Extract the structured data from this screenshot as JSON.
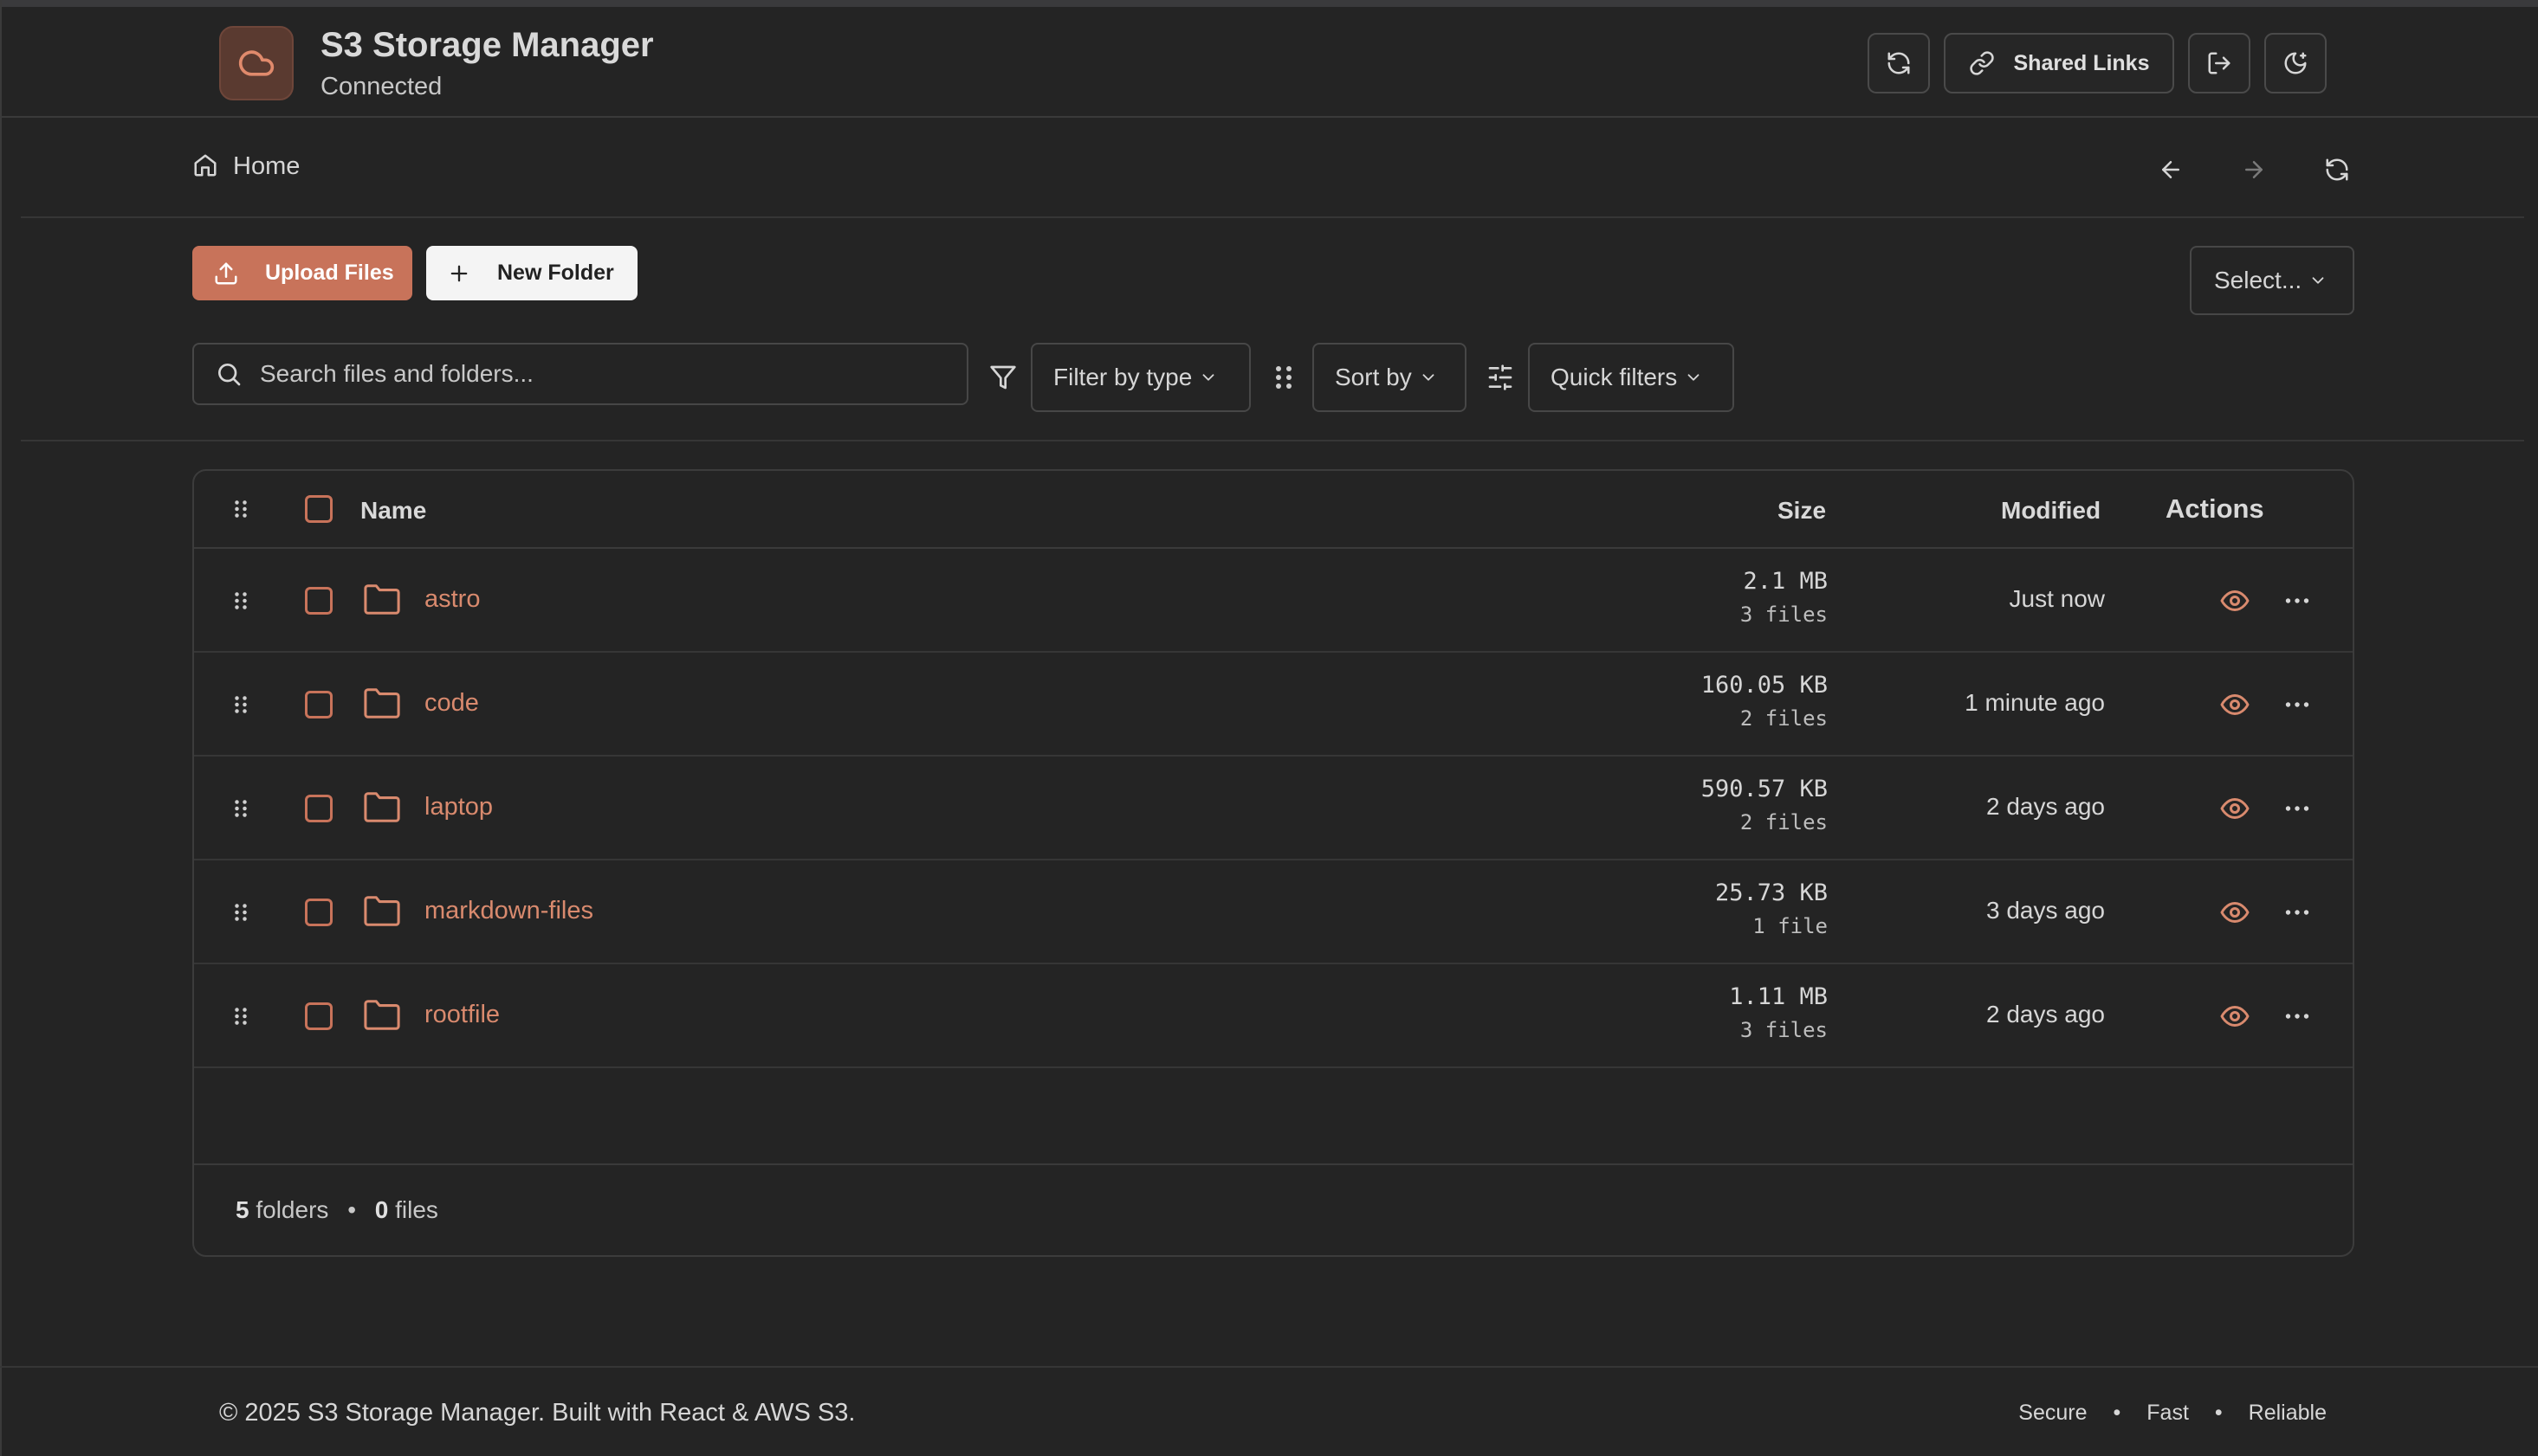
{
  "header": {
    "title": "S3 Storage Manager",
    "status": "Connected",
    "shared_links_label": "Shared Links"
  },
  "breadcrumb": {
    "home_label": "Home"
  },
  "toolbar": {
    "upload_label": "Upload Files",
    "new_folder_label": "New Folder",
    "select_label": "Select...",
    "search_placeholder": "Search files and folders...",
    "filter_type_label": "Filter by type",
    "sort_label": "Sort by",
    "quick_filters_label": "Quick filters"
  },
  "table": {
    "columns": {
      "name": "Name",
      "size": "Size",
      "modified": "Modified",
      "actions": "Actions"
    },
    "rows": [
      {
        "name": "astro",
        "size": "2.1 MB",
        "count": "3 files",
        "modified": "Just now"
      },
      {
        "name": "code",
        "size": "160.05 KB",
        "count": "2 files",
        "modified": "1 minute ago"
      },
      {
        "name": "laptop",
        "size": "590.57 KB",
        "count": "2 files",
        "modified": "2 days ago"
      },
      {
        "name": "markdown-files",
        "size": "25.73 KB",
        "count": "1 file",
        "modified": "3 days ago"
      },
      {
        "name": "rootfile",
        "size": "1.11 MB",
        "count": "3 files",
        "modified": "2 days ago"
      }
    ],
    "summary": {
      "folders_count": "5",
      "folders_label": "folders",
      "separator": "•",
      "files_count": "0",
      "files_label": "files"
    }
  },
  "footer": {
    "copyright": "© 2025 S3 Storage Manager. Built with React & AWS S3.",
    "links": [
      "Secure",
      "Fast",
      "Reliable"
    ],
    "separator": "•"
  },
  "colors": {
    "accent": "#c8735a",
    "background": "#242424",
    "folder_name": "#d98a6e"
  },
  "icons": {
    "logo": "cloud-icon",
    "refresh": "refresh-icon",
    "shared_links": "link-icon",
    "logout": "logout-icon",
    "theme": "theme-toggle-icon",
    "home": "home-icon",
    "back": "arrow-left-icon",
    "forward": "arrow-right-icon",
    "upload": "upload-icon",
    "new_folder": "plus-icon",
    "search": "search-icon",
    "filter": "filter-icon",
    "grip": "drag-handle-icon",
    "sliders": "sliders-icon",
    "folder": "folder-icon",
    "view": "eye-icon",
    "more": "more-icon"
  }
}
